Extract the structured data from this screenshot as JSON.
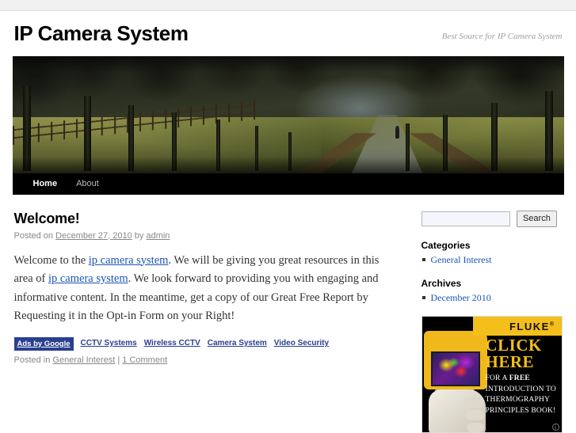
{
  "site": {
    "title": "IP Camera System",
    "description": "Best Source for IP Camera System"
  },
  "nav": {
    "items": [
      {
        "label": "Home",
        "current": true
      },
      {
        "label": "About",
        "current": false
      }
    ]
  },
  "post": {
    "title": "Welcome!",
    "meta_prefix": "Posted on ",
    "date": "December 27, 2010",
    "meta_by": " by ",
    "author": "admin",
    "body": {
      "p1_a": "Welcome to the ",
      "link1": "ip camera system",
      "p1_b": ". We will be giving you great resources in this area of ",
      "link2": "ip camera system",
      "p1_c": ". We look forward to providing you with engaging and informative content. In the meantime, get a copy of our Great Free Report by Requesting it in the Opt-in Form on your Right!"
    },
    "ads": {
      "badge": "Ads by Google",
      "links": [
        "CCTV Systems",
        "Wireless CCTV",
        "Camera System",
        "Video Security"
      ]
    },
    "utility": {
      "posted_in": "Posted in ",
      "category": "General Interest",
      "separator": " | ",
      "comments": "1 Comment"
    }
  },
  "sidebar": {
    "search": {
      "value": "",
      "placeholder": "",
      "button": "Search"
    },
    "widgets": [
      {
        "title": "Categories",
        "items": [
          "General Interest"
        ]
      },
      {
        "title": "Archives",
        "items": [
          "December 2010"
        ]
      }
    ],
    "ad": {
      "brand": "FLUKE",
      "brand_mark": "®",
      "headline_1": "CLICK",
      "headline_2": "HERE",
      "body_1": "FOR A ",
      "body_strong": "FREE",
      "body_2": " INTRODUCTION TO THERMOGRAPHY PRINCIPLES BOOK!",
      "corner_mark": "i"
    }
  },
  "colors": {
    "link": "#1b55b5",
    "ads_blue": "#2a3f8f",
    "fluke_yellow": "#f5bf1b",
    "nav_bg": "#000000",
    "meta_gray": "#888888"
  }
}
